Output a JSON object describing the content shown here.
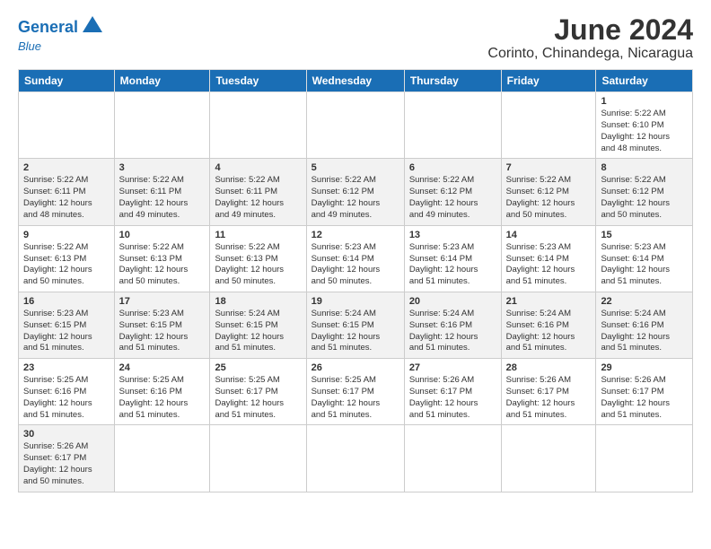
{
  "header": {
    "logo_general": "General",
    "logo_blue": "Blue",
    "main_title": "June 2024",
    "subtitle": "Corinto, Chinandega, Nicaragua"
  },
  "calendar": {
    "days_of_week": [
      "Sunday",
      "Monday",
      "Tuesday",
      "Wednesday",
      "Thursday",
      "Friday",
      "Saturday"
    ],
    "weeks": [
      [
        {
          "date": "",
          "info": ""
        },
        {
          "date": "",
          "info": ""
        },
        {
          "date": "",
          "info": ""
        },
        {
          "date": "",
          "info": ""
        },
        {
          "date": "",
          "info": ""
        },
        {
          "date": "",
          "info": ""
        },
        {
          "date": "1",
          "info": "Sunrise: 5:22 AM\nSunset: 6:10 PM\nDaylight: 12 hours\nand 48 minutes."
        }
      ],
      [
        {
          "date": "2",
          "info": "Sunrise: 5:22 AM\nSunset: 6:11 PM\nDaylight: 12 hours\nand 48 minutes."
        },
        {
          "date": "3",
          "info": "Sunrise: 5:22 AM\nSunset: 6:11 PM\nDaylight: 12 hours\nand 49 minutes."
        },
        {
          "date": "4",
          "info": "Sunrise: 5:22 AM\nSunset: 6:11 PM\nDaylight: 12 hours\nand 49 minutes."
        },
        {
          "date": "5",
          "info": "Sunrise: 5:22 AM\nSunset: 6:12 PM\nDaylight: 12 hours\nand 49 minutes."
        },
        {
          "date": "6",
          "info": "Sunrise: 5:22 AM\nSunset: 6:12 PM\nDaylight: 12 hours\nand 49 minutes."
        },
        {
          "date": "7",
          "info": "Sunrise: 5:22 AM\nSunset: 6:12 PM\nDaylight: 12 hours\nand 50 minutes."
        },
        {
          "date": "8",
          "info": "Sunrise: 5:22 AM\nSunset: 6:12 PM\nDaylight: 12 hours\nand 50 minutes."
        }
      ],
      [
        {
          "date": "9",
          "info": "Sunrise: 5:22 AM\nSunset: 6:13 PM\nDaylight: 12 hours\nand 50 minutes."
        },
        {
          "date": "10",
          "info": "Sunrise: 5:22 AM\nSunset: 6:13 PM\nDaylight: 12 hours\nand 50 minutes."
        },
        {
          "date": "11",
          "info": "Sunrise: 5:22 AM\nSunset: 6:13 PM\nDaylight: 12 hours\nand 50 minutes."
        },
        {
          "date": "12",
          "info": "Sunrise: 5:23 AM\nSunset: 6:14 PM\nDaylight: 12 hours\nand 50 minutes."
        },
        {
          "date": "13",
          "info": "Sunrise: 5:23 AM\nSunset: 6:14 PM\nDaylight: 12 hours\nand 51 minutes."
        },
        {
          "date": "14",
          "info": "Sunrise: 5:23 AM\nSunset: 6:14 PM\nDaylight: 12 hours\nand 51 minutes."
        },
        {
          "date": "15",
          "info": "Sunrise: 5:23 AM\nSunset: 6:14 PM\nDaylight: 12 hours\nand 51 minutes."
        }
      ],
      [
        {
          "date": "16",
          "info": "Sunrise: 5:23 AM\nSunset: 6:15 PM\nDaylight: 12 hours\nand 51 minutes."
        },
        {
          "date": "17",
          "info": "Sunrise: 5:23 AM\nSunset: 6:15 PM\nDaylight: 12 hours\nand 51 minutes."
        },
        {
          "date": "18",
          "info": "Sunrise: 5:24 AM\nSunset: 6:15 PM\nDaylight: 12 hours\nand 51 minutes."
        },
        {
          "date": "19",
          "info": "Sunrise: 5:24 AM\nSunset: 6:15 PM\nDaylight: 12 hours\nand 51 minutes."
        },
        {
          "date": "20",
          "info": "Sunrise: 5:24 AM\nSunset: 6:16 PM\nDaylight: 12 hours\nand 51 minutes."
        },
        {
          "date": "21",
          "info": "Sunrise: 5:24 AM\nSunset: 6:16 PM\nDaylight: 12 hours\nand 51 minutes."
        },
        {
          "date": "22",
          "info": "Sunrise: 5:24 AM\nSunset: 6:16 PM\nDaylight: 12 hours\nand 51 minutes."
        }
      ],
      [
        {
          "date": "23",
          "info": "Sunrise: 5:25 AM\nSunset: 6:16 PM\nDaylight: 12 hours\nand 51 minutes."
        },
        {
          "date": "24",
          "info": "Sunrise: 5:25 AM\nSunset: 6:16 PM\nDaylight: 12 hours\nand 51 minutes."
        },
        {
          "date": "25",
          "info": "Sunrise: 5:25 AM\nSunset: 6:17 PM\nDaylight: 12 hours\nand 51 minutes."
        },
        {
          "date": "26",
          "info": "Sunrise: 5:25 AM\nSunset: 6:17 PM\nDaylight: 12 hours\nand 51 minutes."
        },
        {
          "date": "27",
          "info": "Sunrise: 5:26 AM\nSunset: 6:17 PM\nDaylight: 12 hours\nand 51 minutes."
        },
        {
          "date": "28",
          "info": "Sunrise: 5:26 AM\nSunset: 6:17 PM\nDaylight: 12 hours\nand 51 minutes."
        },
        {
          "date": "29",
          "info": "Sunrise: 5:26 AM\nSunset: 6:17 PM\nDaylight: 12 hours\nand 51 minutes."
        }
      ],
      [
        {
          "date": "30",
          "info": "Sunrise: 5:26 AM\nSunset: 6:17 PM\nDaylight: 12 hours\nand 50 minutes."
        },
        {
          "date": "",
          "info": ""
        },
        {
          "date": "",
          "info": ""
        },
        {
          "date": "",
          "info": ""
        },
        {
          "date": "",
          "info": ""
        },
        {
          "date": "",
          "info": ""
        },
        {
          "date": "",
          "info": ""
        }
      ]
    ]
  }
}
